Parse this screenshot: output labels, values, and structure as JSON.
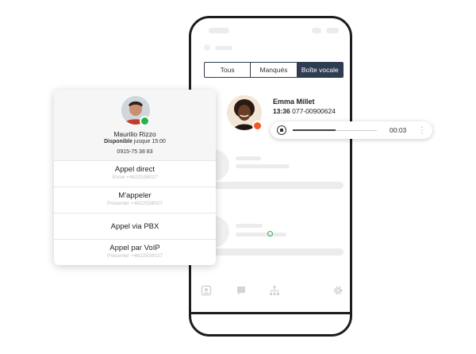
{
  "tabs": [
    {
      "label": "Tous",
      "active": false
    },
    {
      "label": "Manqués",
      "active": false
    },
    {
      "label": "Boîte vocale",
      "active": true
    }
  ],
  "voicemail": {
    "caller_name": "Emma Millet",
    "time": "13:36",
    "number": "077-00900624",
    "duration": "00:03",
    "status_color": "#f05a28"
  },
  "contact": {
    "name": "Maurilio Rizzo",
    "status": "Disponible",
    "status_detail": "jusque 15:00",
    "phone": "0915-75 38 83",
    "status_color": "#27b34a"
  },
  "options": [
    {
      "label": "Appel direct",
      "sub": "Show +4622538027"
    },
    {
      "label": "M'appeler",
      "sub": "Présenter +4622538027"
    },
    {
      "label": "Appel via PBX",
      "sub": ""
    },
    {
      "label": "Appel par VoIP",
      "sub": "Présenter +4622538027"
    }
  ],
  "bottom_nav": [
    "contacts-icon",
    "chat-icon",
    "org-chart-icon",
    "gear-icon"
  ]
}
